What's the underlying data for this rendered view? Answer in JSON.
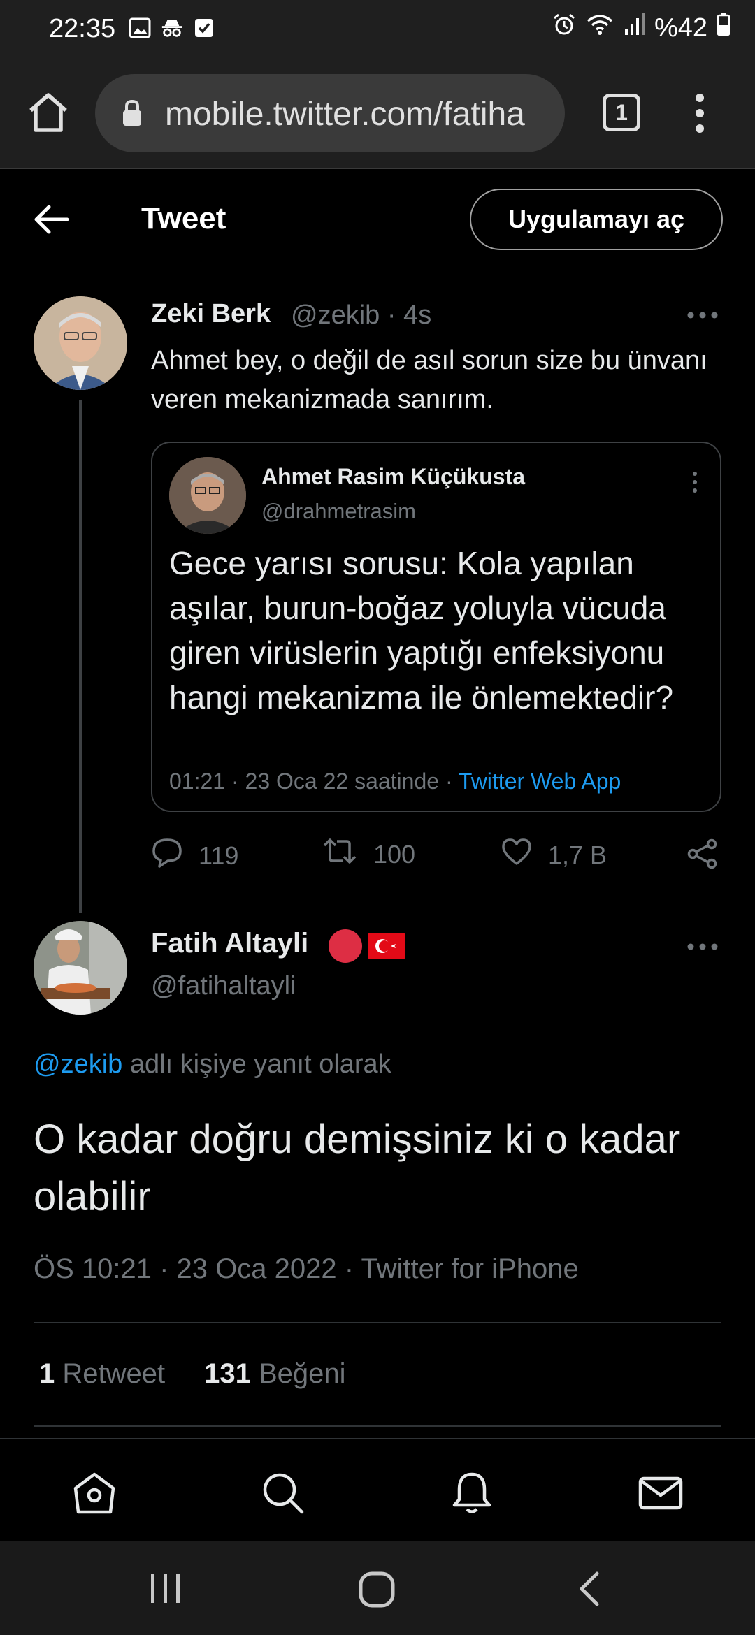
{
  "status_bar": {
    "time": "22:35",
    "battery": "%42"
  },
  "browser": {
    "url": "mobile.twitter.com/fatiha",
    "tab_count": "1"
  },
  "header": {
    "title": "Tweet",
    "open_app_label": "Uygulamayı aç"
  },
  "tweet1": {
    "name": "Zeki Berk",
    "handle": "@zekib · 4s",
    "text": "Ahmet bey, o değil de asıl sorun size bu ünvanı veren mekanizmada sanırım.",
    "quote": {
      "name": "Ahmet Rasim Küçükusta",
      "handle": "@drahmetrasim",
      "text": "Gece yarısı sorusu: Kola yapılan aşılar, burun-boğaz yoluyla vücuda giren virüslerin yaptığı enfeksiyonu hangi mekanizma ile önlemektedir?",
      "meta": "01:21 · 23 Oca 22 saatinde · ",
      "source": "Twitter Web App"
    },
    "actions": {
      "replies": "119",
      "retweets": "100",
      "likes": "1,7 B"
    }
  },
  "tweet2": {
    "name": "Fatih Altayli",
    "handle": "@fatihaltayli",
    "replying_to_handle": "@zekib",
    "replying_to_suffix": " adlı kişiye yanıt olarak",
    "text": "O kadar doğru demişsiniz ki o kadar olabilir",
    "meta": "ÖS 10:21 · 23 Oca 2022 · Twitter for iPhone",
    "retweet_count": "1",
    "retweet_label": "Retweet",
    "like_count": "131",
    "like_label": "Beğeni"
  },
  "icons": {
    "status_left": [
      "image-icon",
      "incognito-icon",
      "checkbox-icon"
    ],
    "status_right": [
      "alarm-icon",
      "wifi-icon",
      "signal-icon",
      "battery-icon"
    ],
    "bottom_nav": [
      "home-icon",
      "search-icon",
      "bell-icon",
      "mail-icon"
    ],
    "system_nav": [
      "recents-icon",
      "home-circle-icon",
      "back-chevron-icon"
    ]
  },
  "colors": {
    "accent": "#1d9bf0",
    "background": "#000000",
    "muted": "#71767b"
  }
}
